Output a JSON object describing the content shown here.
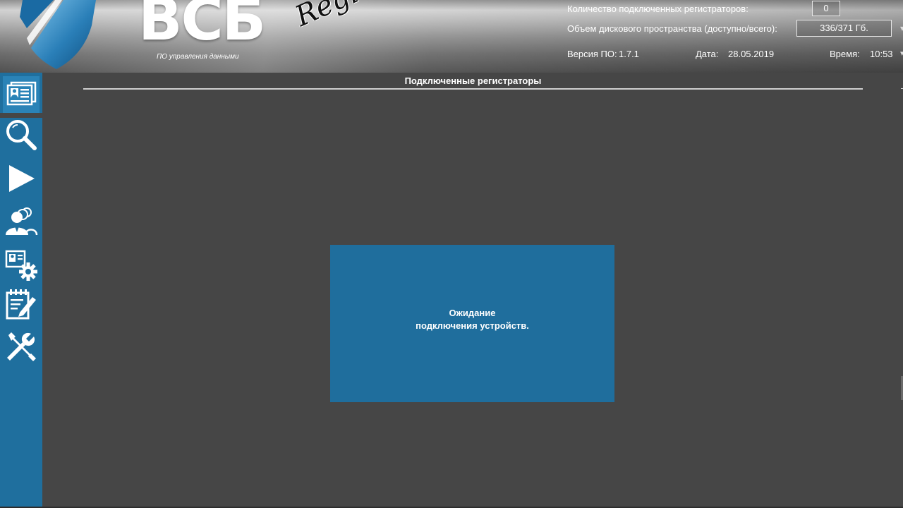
{
  "header": {
    "brand_title": "ВСБ",
    "brand_script": "Registr",
    "brand_subtitle": "ПО управления данными",
    "devices_label": "Количество подключенных регистраторов:",
    "devices_count": "0",
    "disk_label": "Объем дискового пространства (доступно/всего):",
    "disk_value": "336/371 Гб.",
    "version_label": "Версия ПО:",
    "version_value": "1.7.1",
    "date_label": "Дата:",
    "date_value": "28.05.2019",
    "time_label": "Время:",
    "time_value": "10:53"
  },
  "sidebar": {
    "items": [
      {
        "icon": "registrators-icon"
      },
      {
        "icon": "search-icon"
      },
      {
        "icon": "play-icon"
      },
      {
        "icon": "users-icon"
      },
      {
        "icon": "device-settings-icon"
      },
      {
        "icon": "journal-edit-icon"
      },
      {
        "icon": "tools-icon"
      }
    ]
  },
  "main": {
    "section_title": "Подключенные регистраторы",
    "waiting_line1": "Ожидание",
    "waiting_line2": "подключения устройств."
  },
  "colors": {
    "accent_blue": "#1f6f9e",
    "background": "#464646",
    "text": "#ffffff"
  }
}
